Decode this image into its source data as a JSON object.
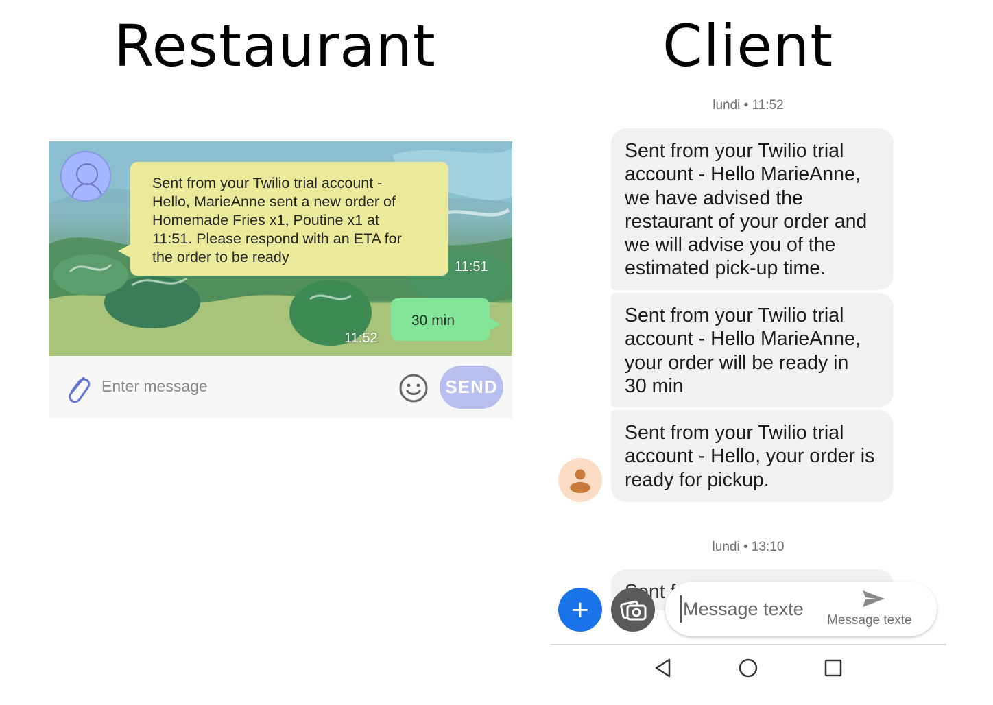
{
  "headings": {
    "restaurant": "Restaurant",
    "client": "Client"
  },
  "restaurant": {
    "incoming_message": {
      "lines": [
        "Sent from your Twilio trial account -",
        "Hello, MarieAnne sent a new order of",
        "Homemade Fries x1,  Poutine x1 at",
        "11:51. Please respond with an ETA for",
        "the order to be ready"
      ],
      "time": "11:51"
    },
    "outgoing_message": {
      "text": "30 min",
      "time": "11:52"
    },
    "input": {
      "placeholder": "Enter message",
      "send_label": "SEND"
    },
    "icons": {
      "attach": "paperclip-icon",
      "emoji": "smiley-icon",
      "avatar": "person-outline-icon"
    }
  },
  "client": {
    "date_separators": [
      "lundi • 11:52",
      "lundi • 13:10"
    ],
    "messages": [
      {
        "lines": [
          "Sent from your Twilio trial",
          "account - Hello MarieAnne,",
          "we have advised the",
          "restaurant of your order and",
          "we will advise you of the",
          "estimated pick-up time."
        ]
      },
      {
        "lines": [
          "Sent from your Twilio trial",
          "account - Hello MarieAnne,",
          "your order will be ready in",
          "30 min"
        ]
      },
      {
        "lines": [
          "Sent from your Twilio trial",
          "account - Hello, your order is",
          "ready for pickup."
        ]
      },
      {
        "lines": [
          "Sent f"
        ]
      }
    ],
    "compose": {
      "placeholder": "Message texte",
      "send_caption": "Message texte"
    },
    "icons": {
      "add": "plus-icon",
      "camera": "camera-gallery-icon",
      "send": "send-arrow-icon",
      "avatar": "person-icon"
    },
    "nav": {
      "back": "back-triangle-icon",
      "home": "home-circle-icon",
      "recent": "recent-square-icon"
    },
    "colors": {
      "accent": "#1a73e8",
      "bubble": "#f1f1f1",
      "avatar_bg": "#fbdcc4",
      "avatar_fg": "#c97b3c"
    }
  }
}
